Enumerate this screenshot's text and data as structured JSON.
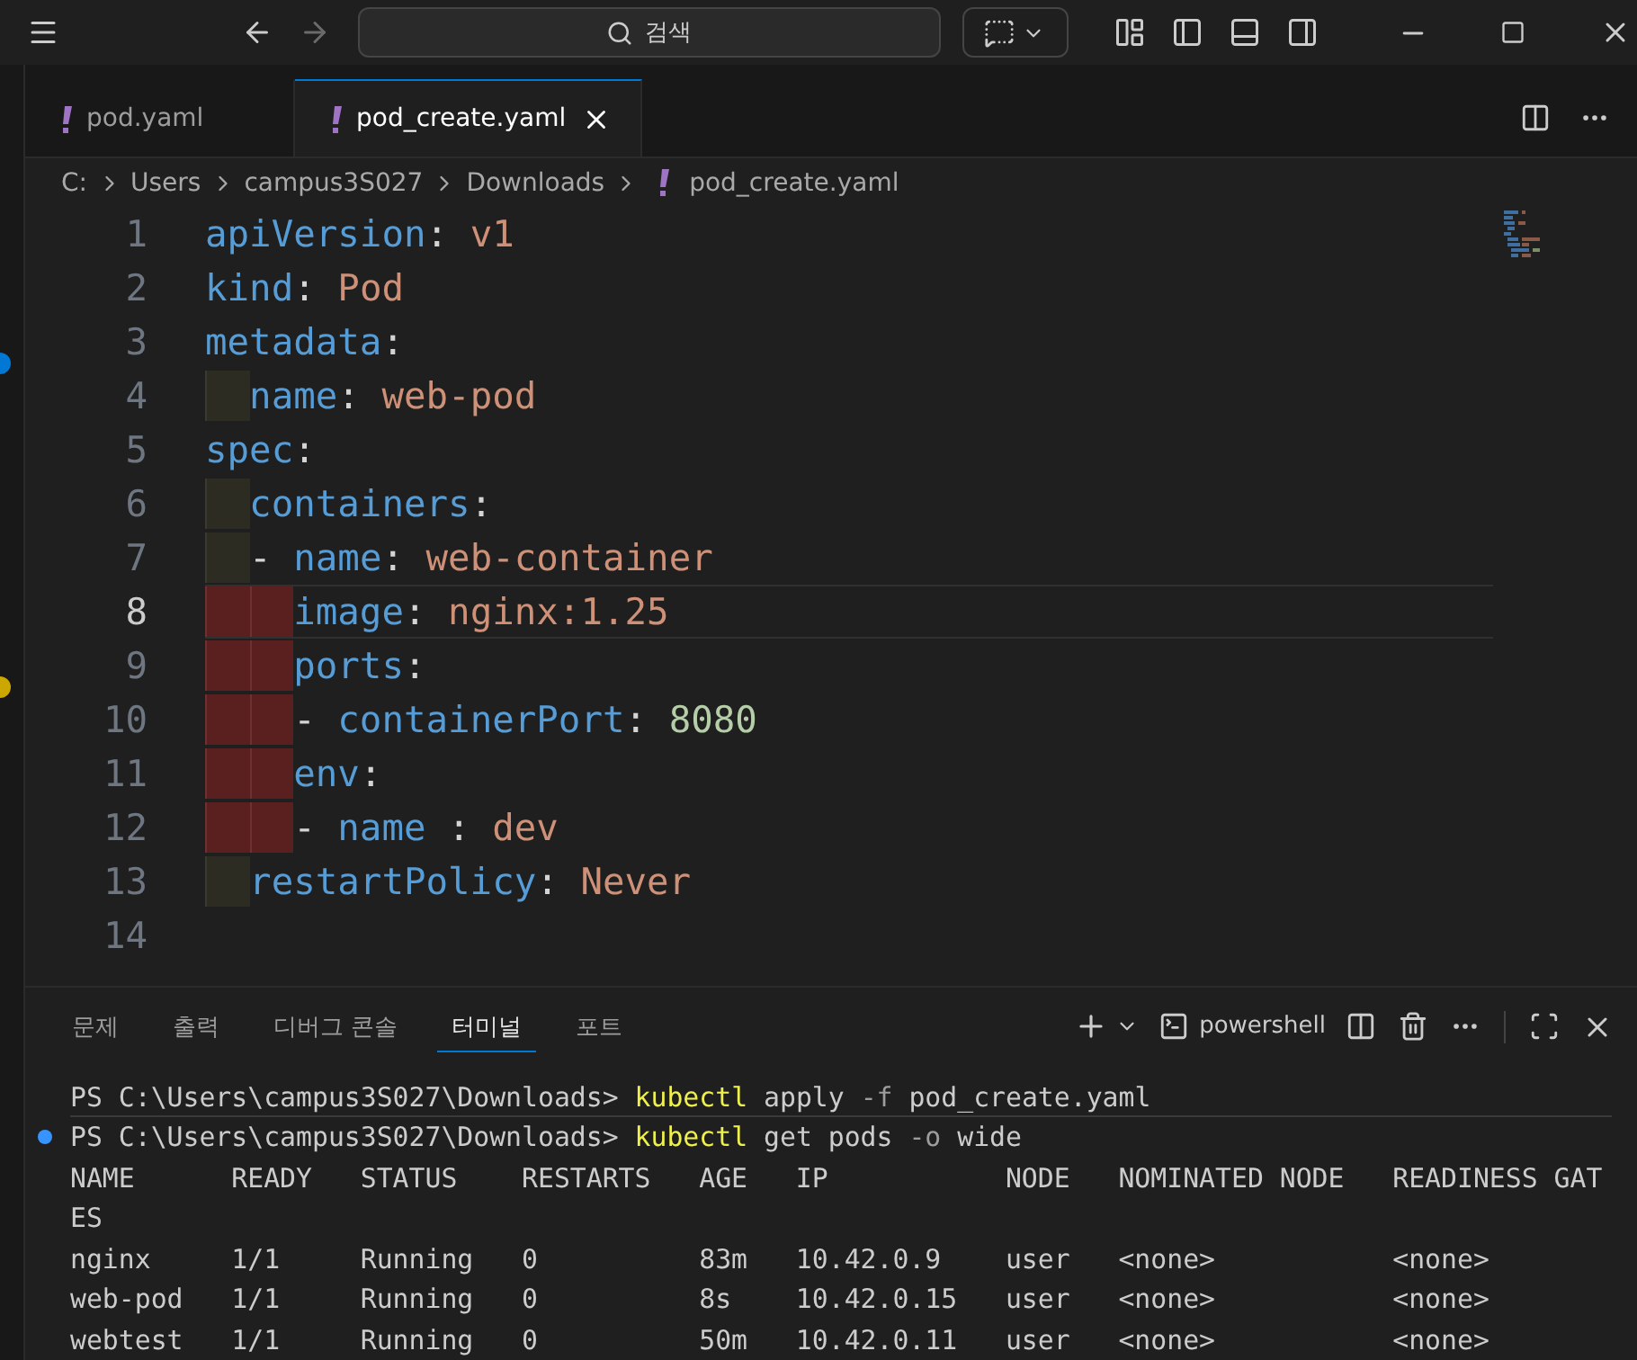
{
  "title_bar": {
    "search_label": "검색",
    "forward_disabled": true
  },
  "editor_tabs": [
    {
      "label": "pod.yaml",
      "selected": false
    },
    {
      "label": "pod_create.yaml",
      "selected": true
    }
  ],
  "breadcrumb": [
    "C:",
    "Users",
    "campus3S027",
    "Downloads",
    "pod_create.yaml"
  ],
  "editor_lines": [
    {
      "number": "1",
      "active": false,
      "tokens": [
        {
          "text": "apiVersion",
          "kind": "key"
        },
        {
          "text": ": ",
          "kind": "punct"
        },
        {
          "text": "v1",
          "kind": "string"
        }
      ]
    },
    {
      "number": "2",
      "active": false,
      "tokens": [
        {
          "text": "kind",
          "kind": "key"
        },
        {
          "text": ": ",
          "kind": "punct"
        },
        {
          "text": "Pod",
          "kind": "string"
        }
      ]
    },
    {
      "number": "3",
      "active": false,
      "tokens": [
        {
          "text": "metadata",
          "kind": "key"
        },
        {
          "text": ":",
          "kind": "punct"
        }
      ]
    },
    {
      "number": "4",
      "active": false,
      "indent": [
        {
          "kind": "warning"
        }
      ],
      "tokens": [
        {
          "text": "name",
          "kind": "key"
        },
        {
          "text": ": ",
          "kind": "punct"
        },
        {
          "text": "web-pod",
          "kind": "string"
        }
      ]
    },
    {
      "number": "5",
      "active": false,
      "tokens": [
        {
          "text": "spec",
          "kind": "key"
        },
        {
          "text": ":",
          "kind": "punct"
        }
      ]
    },
    {
      "number": "6",
      "active": false,
      "indent": [
        {
          "kind": "warning"
        }
      ],
      "tokens": [
        {
          "text": "containers",
          "kind": "key"
        },
        {
          "text": ":",
          "kind": "punct"
        }
      ]
    },
    {
      "number": "7",
      "active": false,
      "indent": [
        {
          "kind": "warning"
        }
      ],
      "tokens": [
        {
          "text": "- ",
          "kind": "punct"
        },
        {
          "text": "name",
          "kind": "key"
        },
        {
          "text": ": ",
          "kind": "punct"
        },
        {
          "text": "web-container",
          "kind": "string"
        }
      ]
    },
    {
      "number": "8",
      "active": true,
      "indent": [
        {
          "kind": "error"
        },
        {
          "kind": "error"
        }
      ],
      "tokens": [
        {
          "text": "image",
          "kind": "key"
        },
        {
          "text": ": ",
          "kind": "punct"
        },
        {
          "text": "nginx:1.25",
          "kind": "string"
        }
      ]
    },
    {
      "number": "9",
      "active": false,
      "indent": [
        {
          "kind": "error"
        },
        {
          "kind": "error"
        }
      ],
      "tokens": [
        {
          "text": "ports",
          "kind": "key"
        },
        {
          "text": ":",
          "kind": "punct"
        }
      ]
    },
    {
      "number": "10",
      "active": false,
      "indent": [
        {
          "kind": "error"
        },
        {
          "kind": "error"
        }
      ],
      "tokens": [
        {
          "text": "- ",
          "kind": "punct"
        },
        {
          "text": "containerPort",
          "kind": "key"
        },
        {
          "text": ": ",
          "kind": "punct"
        },
        {
          "text": "8080",
          "kind": "number"
        }
      ]
    },
    {
      "number": "11",
      "active": false,
      "indent": [
        {
          "kind": "error"
        },
        {
          "kind": "error"
        }
      ],
      "tokens": [
        {
          "text": "env",
          "kind": "key"
        },
        {
          "text": ":",
          "kind": "punct"
        }
      ]
    },
    {
      "number": "12",
      "active": false,
      "indent": [
        {
          "kind": "error"
        },
        {
          "kind": "error"
        }
      ],
      "tokens": [
        {
          "text": "- ",
          "kind": "punct"
        },
        {
          "text": "name",
          "kind": "key"
        },
        {
          "text": " : ",
          "kind": "punct"
        },
        {
          "text": "dev",
          "kind": "string"
        }
      ]
    },
    {
      "number": "13",
      "active": false,
      "indent": [
        {
          "kind": "warning"
        }
      ],
      "tokens": [
        {
          "text": "restartPolicy",
          "kind": "key"
        },
        {
          "text": ": ",
          "kind": "punct"
        },
        {
          "text": "Never",
          "kind": "string"
        }
      ]
    },
    {
      "number": "14",
      "active": false
    }
  ],
  "panel_tabs": [
    {
      "label": "문제",
      "selected": false
    },
    {
      "label": "출력",
      "selected": false
    },
    {
      "label": "디버그 콘솔",
      "selected": false
    },
    {
      "label": "터미널",
      "selected": true
    },
    {
      "label": "포트",
      "selected": false
    }
  ],
  "terminal_profile": "powershell",
  "terminal_lines": [
    {
      "decorated": false,
      "segments": [
        {
          "text": "PS C:\\Users\\campus3S027\\Downloads> ",
          "kind": "plain"
        },
        {
          "text": "kubectl",
          "kind": "command"
        },
        {
          "text": " apply ",
          "kind": "plain"
        },
        {
          "text": "-f",
          "kind": "flag"
        },
        {
          "text": " pod_create.yaml",
          "kind": "plain"
        }
      ]
    },
    {
      "decorated": true,
      "segments": [
        {
          "text": "PS C:\\Users\\campus3S027\\Downloads> ",
          "kind": "plain"
        },
        {
          "text": "kubectl",
          "kind": "command"
        },
        {
          "text": " get pods ",
          "kind": "plain"
        },
        {
          "text": "-o",
          "kind": "flag"
        },
        {
          "text": " wide",
          "kind": "plain"
        }
      ]
    },
    {
      "decorated": false,
      "segments": [
        {
          "text": "NAME      READY   STATUS    RESTARTS   AGE   IP           NODE   NOMINATED NODE   READINESS GAT",
          "kind": "plain"
        }
      ]
    },
    {
      "decorated": false,
      "segments": [
        {
          "text": "ES",
          "kind": "plain"
        }
      ]
    },
    {
      "decorated": false,
      "segments": [
        {
          "text": "nginx     1/1     Running   0          83m   10.42.0.9    user   <none>           <none>",
          "kind": "plain"
        }
      ]
    },
    {
      "decorated": false,
      "segments": [
        {
          "text": "web-pod   1/1     Running   0          8s    10.42.0.15   user   <none>           <none>",
          "kind": "plain"
        }
      ]
    },
    {
      "decorated": false,
      "segments": [
        {
          "text": "webtest   1/1     Running   0          50m   10.42.0.11   user   <none>           <none>",
          "kind": "plain"
        }
      ]
    }
  ]
}
